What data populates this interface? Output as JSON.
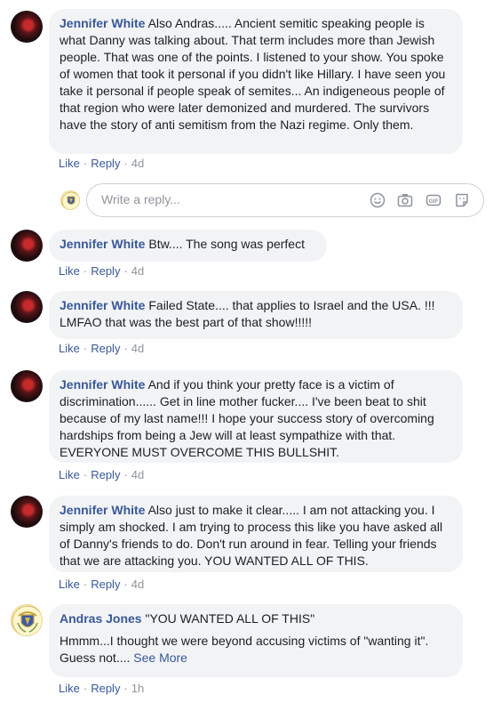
{
  "comments": [
    {
      "author": "Jennifer White",
      "text": "Also Andras..... Ancient semitic speaking people is what Danny was talking about. That term includes more than Jewish people. That was one of the points. I listened to your show. You spoke of women that took it personal if you didn't like Hillary. I have seen you take it personal if people speak of semites... An indigeneous people of that region who were later demonized and murdered. The survivors have the story of anti semitism from the Nazi regime. Only them.",
      "like": "Like",
      "reply": "Reply",
      "time": "4d"
    },
    {
      "author": "Jennifer White",
      "text": "Btw.... The song was perfect",
      "like": "Like",
      "reply": "Reply",
      "time": "4d"
    },
    {
      "author": "Jennifer White",
      "text": "Failed State.... that applies to Israel and the USA. !!! LMFAO that was the best part of that show!!!!!",
      "like": "Like",
      "reply": "Reply",
      "time": "4d"
    },
    {
      "author": "Jennifer White",
      "text": "And if you think your pretty face is a victim of discrimination...... Get in line mother fucker.... I've been beat to shit because of my last name!!! I hope your success story of overcoming hardships from being a Jew will at least sympathize with that. EVERYONE MUST OVERCOME THIS BULLSHIT.",
      "like": "Like",
      "reply": "Reply",
      "time": "4d"
    },
    {
      "author": "Jennifer White",
      "text": "Also just to make it clear..... I am not attacking you. I simply am shocked. I am trying to process this like you have asked all of Danny's friends to do. Don't run around in fear. Telling your friends that we are attacking you. YOU WANTED ALL OF THIS.",
      "like": "Like",
      "reply": "Reply",
      "time": "4d"
    },
    {
      "author": "Andras Jones",
      "text": "\"YOU WANTED ALL OF THIS\"",
      "text2": "Hmmm...I thought we were beyond accusing victims of \"wanting it\". Guess not.... ",
      "see_more": "See More",
      "like": "Like",
      "reply": "Reply",
      "time": "1h"
    }
  ],
  "reply_box": {
    "placeholder": "Write a reply..."
  },
  "icons": [
    "emoji-icon",
    "camera-icon",
    "gif-icon",
    "sticker-icon"
  ]
}
